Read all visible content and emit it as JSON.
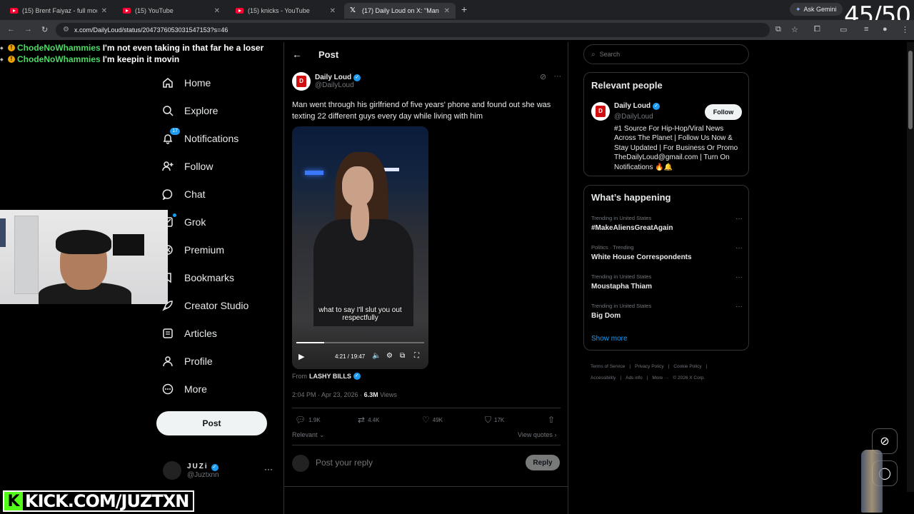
{
  "browser": {
    "tabs": [
      {
        "title": "(15) Brent Faiyaz - full moon. (",
        "icon": "youtube-icon",
        "active": false
      },
      {
        "title": "(15) YouTube",
        "icon": "youtube-icon",
        "active": false
      },
      {
        "title": "(15) knicks - YouTube",
        "icon": "youtube-icon",
        "active": false
      },
      {
        "title": "(17) Daily Loud on X: \"Man wen",
        "icon": "x-icon",
        "active": true
      }
    ],
    "new_tab": "+",
    "gemini_label": "Ask Gemini",
    "url": "x.com/DailyLoud/status/2047376053031547153?s=46"
  },
  "overlay": {
    "counter": "45/50",
    "chat": [
      {
        "user": "ChodeNoWhammies",
        "message": "I'm not even taking in that far he a loser"
      },
      {
        "user": "ChodeNoWhammies",
        "message": "I'm keepin it movin"
      }
    ],
    "kick_url": "KICK.COM/JUZTXN",
    "kick_logo": "K"
  },
  "sidebar": {
    "items": [
      {
        "label": "Home",
        "icon": "home-icon"
      },
      {
        "label": "Explore",
        "icon": "search-icon"
      },
      {
        "label": "Notifications",
        "icon": "bell-icon",
        "badge": "17"
      },
      {
        "label": "Follow",
        "icon": "person-add-icon"
      },
      {
        "label": "Chat",
        "icon": "chat-icon"
      },
      {
        "label": "Grok",
        "icon": "grok-icon"
      },
      {
        "label": "Premium",
        "icon": "x-premium-icon"
      },
      {
        "label": "Bookmarks",
        "icon": "bookmark-icon"
      },
      {
        "label": "Creator Studio",
        "icon": "rocket-icon"
      },
      {
        "label": "Articles",
        "icon": "article-icon"
      },
      {
        "label": "Profile",
        "icon": "person-icon"
      },
      {
        "label": "More",
        "icon": "more-circle-icon"
      }
    ],
    "post_button": "Post",
    "account": {
      "name": "JUZi",
      "handle": "@Juztxnn"
    }
  },
  "post": {
    "header": "Post",
    "author": {
      "name": "Daily Loud",
      "handle": "@DailyLoud"
    },
    "text": "Man went through his girlfriend of five years' phone and found out she was texting 22 different guys every day while living with him",
    "video": {
      "caption_line1": "what to say I'll slut you out",
      "caption_line2": "respectfully",
      "time": "4:21 / 19:47",
      "progress": 0.22
    },
    "from_label": "From",
    "from_name": "LASHY BILLS",
    "timestamp": "2:04 PM · Apr 23, 2026 · ",
    "views_count": "6.3M",
    "views_label": " Views",
    "stats": {
      "replies": "1.9K",
      "reposts": "4.4K",
      "likes": "49K",
      "bookmarks": "17K"
    },
    "relevant": "Relevant",
    "view_quotes": "View quotes",
    "reply_placeholder": "Post your reply",
    "reply_button": "Reply"
  },
  "right": {
    "search_placeholder": "Search",
    "relevant_people": {
      "title": "Relevant people",
      "name": "Daily Loud",
      "handle": "@DailyLoud",
      "follow": "Follow",
      "bio": "#1 Source For Hip-Hop/Viral News Across The Planet | Follow Us Now & Stay Updated | For Business Or Promo TheDailyLoud@gmail.com | Turn On Notifications 🔥🔔"
    },
    "happening": {
      "title": "What’s happening",
      "trends": [
        {
          "context": "Trending in United States",
          "name": "#MakeAliensGreatAgain"
        },
        {
          "context": "Politics · Trending",
          "name": "White House Correspondents"
        },
        {
          "context": "Trending in United States",
          "name": "Moustapha Thiam"
        },
        {
          "context": "Trending in United States",
          "name": "Big Dom"
        }
      ],
      "show_more": "Show more"
    },
    "footer": [
      "Terms of Service",
      "|",
      "Privacy Policy",
      "|",
      "Cookie Policy",
      "|",
      "Accessibility",
      "|",
      "Ads info",
      "|",
      "More ···",
      "© 2026 X Corp."
    ]
  },
  "colors": {
    "accent": "#1d9bf0",
    "kick_green": "#53fc18",
    "chat_user": "#4cd964"
  }
}
